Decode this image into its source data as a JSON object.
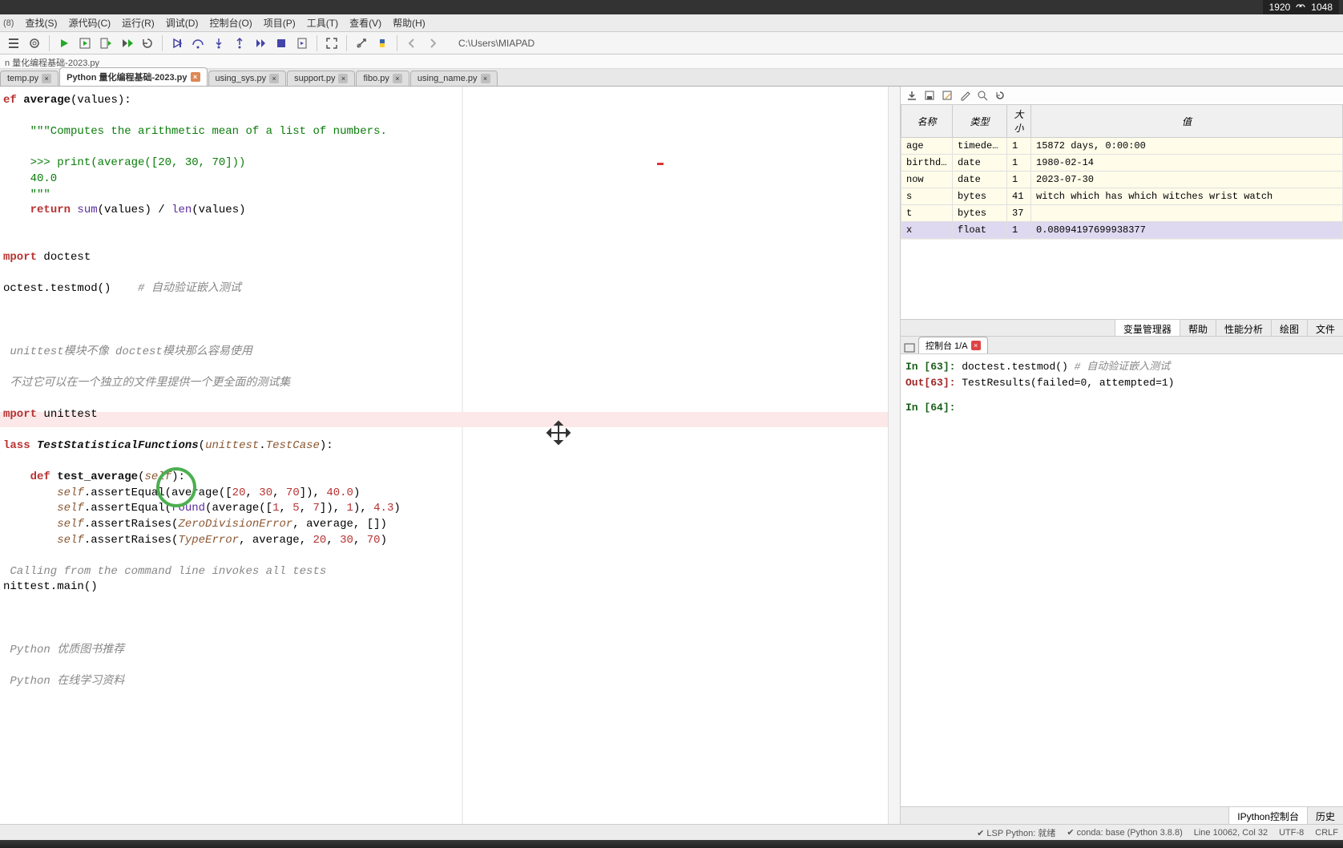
{
  "screen": {
    "w": "1920",
    "h": "1048"
  },
  "menubar_left_corner": "(8)",
  "menu": {
    "search": "查找(S)",
    "source": "源代码(C)",
    "run": "运行(R)",
    "debug": "调试(D)",
    "console": "控制台(O)",
    "project": "项目(P)",
    "tools": "工具(T)",
    "view": "查看(V)",
    "help": "帮助(H)"
  },
  "toolbar_path": "C:\\Users\\MIAPAD",
  "breadcrumb": "n 量化编程基础-2023.py",
  "tabs": [
    {
      "name": "temp.py",
      "close": "x",
      "active": false,
      "mod": false
    },
    {
      "name": "Python 量化编程基础-2023.py",
      "close": "x",
      "active": true,
      "mod": true
    },
    {
      "name": "using_sys.py",
      "close": "x",
      "active": false,
      "mod": false
    },
    {
      "name": "support.py",
      "close": "x",
      "active": false,
      "mod": false
    },
    {
      "name": "fibo.py",
      "close": "x",
      "active": false,
      "mod": false
    },
    {
      "name": "using_name.py",
      "close": "x",
      "active": false,
      "mod": false
    }
  ],
  "code": {
    "l1a": "ef ",
    "l1b": "average",
    "l1c": "(values):",
    "l3": "    \"\"\"Computes the arithmetic mean of a list of numbers.",
    "l5": "    >>> print(average([20, 30, 70]))",
    "l6": "    40.0",
    "l7": "    \"\"\"",
    "l8a": "    ",
    "l8b": "return",
    "l8c": " sum",
    "l8d": "(values) / ",
    "l8e": "len",
    "l8f": "(values)",
    "l11a": "mport",
    "l11b": " doctest",
    "l13a": "octest.testmod()    ",
    "l13b": "# 自动验证嵌入测试",
    "l17": " unittest模块不像 doctest模块那么容易使用",
    "l19": " 不过它可以在一个独立的文件里提供一个更全面的测试集",
    "l21a": "mport",
    "l21b": " unittest",
    "l23a": "lass ",
    "l23b": "TestStatisticalFunctions",
    "l23c": "(",
    "l23d": "unittest",
    "l23e": ".",
    "l23f": "TestCase",
    "l23g": "):",
    "l25a": "    ",
    "l25b": "def",
    "l25c": " ",
    "l25d": "test_average",
    "l25e": "(",
    "l25f": "self",
    "l25g": "):",
    "l26a": "        ",
    "l26b": "self",
    "l26c": ".assertEqual(average([",
    "l26d": "20",
    "l26e": ", ",
    "l26f": "30",
    "l26g": ", ",
    "l26h": "70",
    "l26i": "]), ",
    "l26j": "40.0",
    "l26k": ")",
    "l27a": "        ",
    "l27b": "self",
    "l27c": ".assertEqual(",
    "l27d": "round",
    "l27e": "(average([",
    "l27f": "1",
    "l27g": ", ",
    "l27h": "5",
    "l27i": ", ",
    "l27j": "7",
    "l27k": "]), ",
    "l27l": "1",
    "l27m": "), ",
    "l27n": "4.3",
    "l27o": ")",
    "l28a": "        ",
    "l28b": "self",
    "l28c": ".assertRaises(",
    "l28d": "ZeroDivisionError",
    "l28e": ", average, [])",
    "l29a": "        ",
    "l29b": "self",
    "l29c": ".assertRaises(",
    "l29d": "TypeError",
    "l29e": ", average, ",
    "l29f": "20",
    "l29g": ", ",
    "l29h": "30",
    "l29i": ", ",
    "l29j": "70",
    "l29k": ")",
    "l31": " Calling from the command line invokes all tests",
    "l32": "nittest.main()",
    "l36": " Python 优质图书推荐",
    "l38": " Python 在线学习资料"
  },
  "vars": {
    "headers": {
      "name": "名称",
      "type": "类型",
      "size": "大小",
      "value": "值"
    },
    "rows": [
      {
        "name": "age",
        "type": "timedelta",
        "size": "1",
        "value": "15872 days, 0:00:00",
        "hl": false
      },
      {
        "name": "birthday",
        "type": "date",
        "size": "1",
        "value": "1980-02-14",
        "hl": false
      },
      {
        "name": "now",
        "type": "date",
        "size": "1",
        "value": "2023-07-30",
        "hl": false
      },
      {
        "name": "s",
        "type": "bytes",
        "size": "41",
        "value": "witch which has which witches wrist watch",
        "hl": false
      },
      {
        "name": "t",
        "type": "bytes",
        "size": "37",
        "value": "",
        "hl": false
      },
      {
        "name": "x",
        "type": "float",
        "size": "1",
        "value": "0.08094197699938377",
        "hl": true
      }
    ]
  },
  "right_tabs": {
    "varmgr": "变量管理器",
    "help": "帮助",
    "profile": "性能分析",
    "plot": "绘图",
    "file": "文件"
  },
  "console_tab": {
    "label": "控制台 1/A"
  },
  "console": {
    "in63_label": "In [",
    "in63_num": "63",
    "in63_close": "]: ",
    "in63_code": "doctest.testmod()",
    "in63_comment_sep": "     ",
    "in63_comment": "# 自动验证嵌入测试",
    "out63_label": "Out[",
    "out63_num": "63",
    "out63_close": "]: ",
    "out63_val": "TestResults(failed=0, attempted=1)",
    "in64_label": "In [",
    "in64_num": "64",
    "in64_close": "]: "
  },
  "console_bottom_tabs": {
    "ipython": "IPython控制台",
    "history": "历史"
  },
  "status": {
    "lsp": "✔ LSP Python: 就绪",
    "conda": "✔ conda: base (Python 3.8.8)",
    "linecol": "Line 10062, Col 32",
    "encoding": "UTF-8",
    "eol": "CRLF"
  }
}
